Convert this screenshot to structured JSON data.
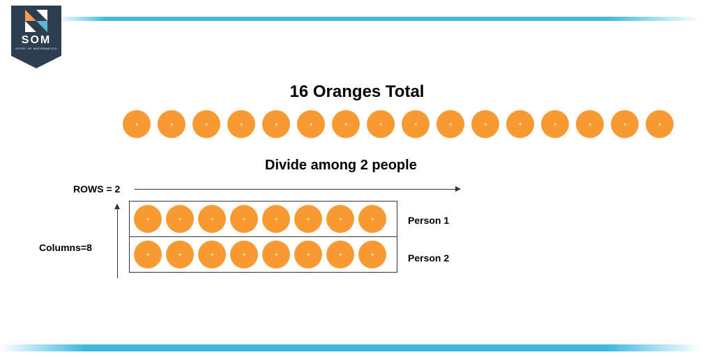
{
  "logo": {
    "text": "SOM",
    "subtext": "STORY OF MATHEMATICS"
  },
  "title": "16 Oranges Total",
  "subtitle": "Divide among 2 people",
  "labels": {
    "rows": "ROWS = 2",
    "columns": "Columns=8",
    "person1": "Person 1",
    "person2": "Person 2"
  },
  "chart_data": {
    "type": "diagram",
    "total_items": 16,
    "divide_among": 2,
    "rows": 2,
    "columns": 8,
    "result_per_person": 8,
    "item_label": "Oranges",
    "item_color": "#f79a32"
  }
}
